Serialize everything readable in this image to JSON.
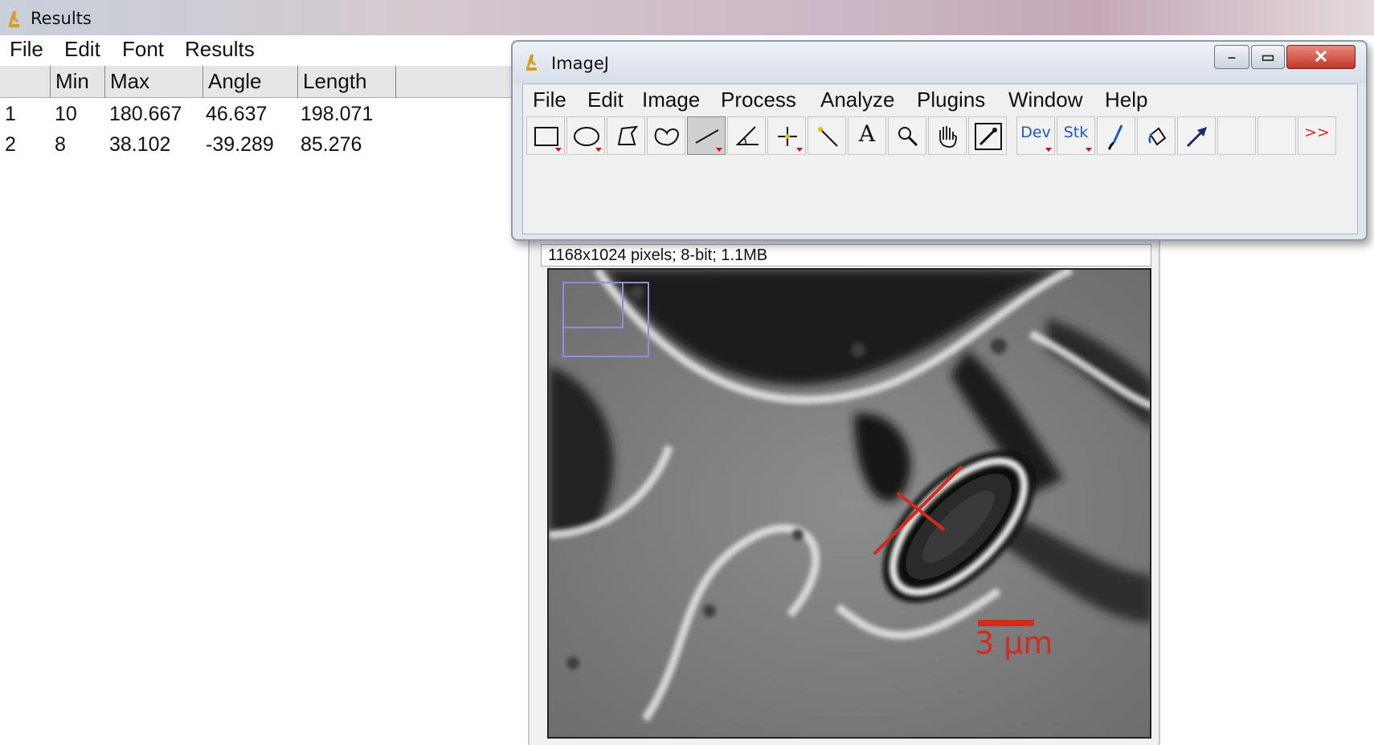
{
  "results_window": {
    "title": "Results",
    "menu": [
      "File",
      "Edit",
      "Font",
      "Results"
    ],
    "columns": [
      "",
      "Min",
      "Max",
      "Angle",
      "Length"
    ],
    "rows": [
      [
        "1",
        "10",
        "180.667",
        "46.637",
        "198.071"
      ],
      [
        "2",
        "8",
        "38.102",
        "-39.289",
        "85.276"
      ]
    ]
  },
  "imagej_window": {
    "title": "ImageJ",
    "menu": [
      "File",
      "Edit",
      "Image",
      "Process",
      "Analyze",
      "Plugins",
      "Window",
      "Help"
    ],
    "tools": [
      {
        "icon": "rectangle-select-icon"
      },
      {
        "icon": "oval-select-icon"
      },
      {
        "icon": "polygon-select-icon"
      },
      {
        "icon": "freehand-select-icon"
      },
      {
        "icon": "line-tool-icon",
        "selected": true
      },
      {
        "icon": "angle-tool-icon"
      },
      {
        "icon": "point-tool-icon"
      },
      {
        "icon": "wand-tool-icon"
      },
      {
        "icon": "text-tool-icon",
        "label": "A"
      },
      {
        "icon": "magnifier-icon"
      },
      {
        "icon": "hand-tool-icon"
      },
      {
        "icon": "color-picker-icon"
      },
      {
        "icon": "developer-menu-icon",
        "label": "Dev"
      },
      {
        "icon": "stack-menu-icon",
        "label": "Stk"
      },
      {
        "icon": "brush-tool-icon"
      },
      {
        "icon": "flood-fill-icon"
      },
      {
        "icon": "arrow-tool-icon"
      },
      {
        "icon": "empty-slot-icon"
      },
      {
        "icon": "empty-slot-icon"
      },
      {
        "icon": "more-tools-icon",
        "label": ">>"
      }
    ]
  },
  "image_window": {
    "info": "1168x1024 pixels; 8-bit; 1.1MB",
    "scale_bar_label": "3 μm",
    "accent_color": "#d42a1e",
    "roi_color": "#8f8fe0"
  }
}
